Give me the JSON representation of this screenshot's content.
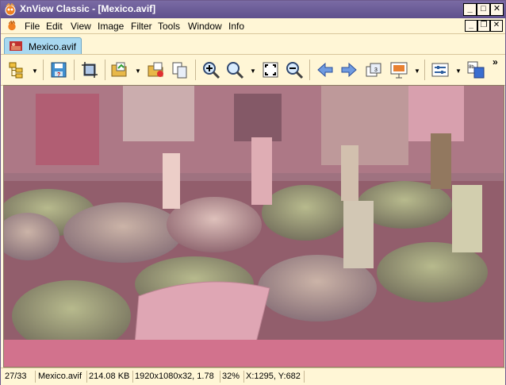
{
  "window": {
    "title": "XnView Classic - [Mexico.avif]"
  },
  "menu": [
    "File",
    "Edit",
    "View",
    "Image",
    "Filter",
    "Tools",
    "Window",
    "Info"
  ],
  "tab": {
    "label": "Mexico.avif"
  },
  "status": {
    "index": "27/33",
    "filename": "Mexico.avif",
    "filesize": "214.08 KB",
    "dimensions": "1920x1080x32, 1.78",
    "zoom": "32%",
    "coords": "X:1295, Y:682"
  },
  "colors": {
    "titlebar": "#5E4F8C",
    "chrome": "#FFF6D6",
    "tab": "#A8D8F0"
  }
}
